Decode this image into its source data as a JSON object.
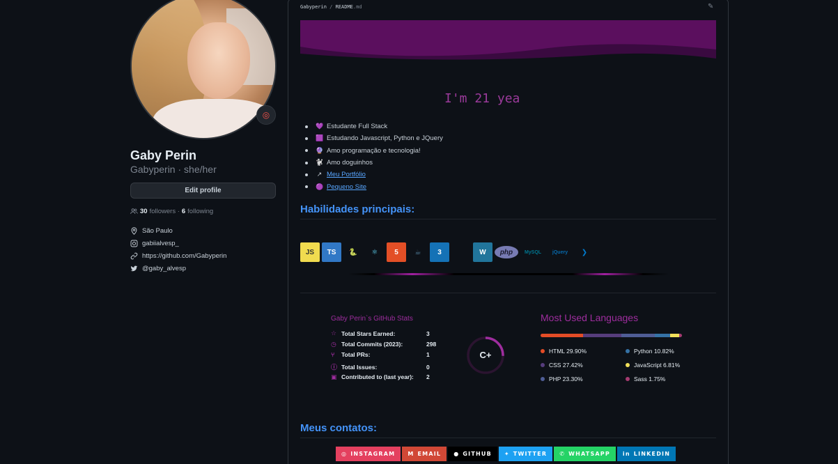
{
  "profile": {
    "name": "Gaby Perin",
    "username_pronouns": "Gabyperin · she/her",
    "edit_label": "Edit profile",
    "followers_count": "30",
    "followers_label": "followers ·",
    "following_count": "6",
    "following_label": "following",
    "location": "São Paulo",
    "instagram": "gabiialvesp_",
    "website": "https://github.com/Gabyperin",
    "twitter": "@gaby_alvesp"
  },
  "readme": {
    "path_user": "Gabyperin",
    "path_sep": "/",
    "path_file": "README",
    "path_ext": ".md",
    "typing_text": "I'm 21 yea",
    "bullets": [
      {
        "emoji": "💜",
        "text": "Estudante Full Stack"
      },
      {
        "emoji": "🟪",
        "text": "Estudando Javascript, Python e JQuery"
      },
      {
        "emoji": "🔮",
        "text": "Amo programação e tecnologia!"
      },
      {
        "emoji": "🐩",
        "text": "Amo doguinhos"
      },
      {
        "emoji": "↗",
        "text": "Meu Portfólio",
        "link": true
      },
      {
        "emoji": "🟣",
        "text": "Pequeno Site",
        "link": true
      }
    ],
    "skills_heading": "Habilidades principais:",
    "skills": [
      {
        "name": "JS",
        "bg": "#f0db4f",
        "fg": "#323330"
      },
      {
        "name": "TS",
        "bg": "#3178c6",
        "fg": "#ffffff"
      },
      {
        "name": "🐍",
        "bg": "transparent",
        "fg": "#3776ab"
      },
      {
        "name": "⚛",
        "bg": "transparent",
        "fg": "#61dafb"
      },
      {
        "name": "5",
        "bg": "#e34f26",
        "fg": "#ffffff"
      },
      {
        "name": "☕",
        "bg": "transparent",
        "fg": "#5382a1"
      },
      {
        "name": "3",
        "bg": "#1572b6",
        "fg": "#ffffff"
      },
      {
        "name": "",
        "bg": "transparent",
        "fg": "#0d1117"
      },
      {
        "name": "W",
        "bg": "#21759b",
        "fg": "#ffffff"
      },
      {
        "name": "php",
        "bg": "#777bb3",
        "fg": "#1b1b2f"
      },
      {
        "name": "MySQL",
        "bg": "transparent",
        "fg": "#00758f"
      },
      {
        "name": "jQuery",
        "bg": "transparent",
        "fg": "#0769ad"
      },
      {
        "name": "❯",
        "bg": "transparent",
        "fg": "#007acc"
      }
    ],
    "stats": {
      "title": "Gaby Perin`s GitHub Stats",
      "rows": [
        {
          "icon": "☆",
          "label": "Total Stars Earned:",
          "value": "3"
        },
        {
          "icon": "◷",
          "label": "Total Commits (2023):",
          "value": "298"
        },
        {
          "icon": "⑂",
          "label": "Total PRs:",
          "value": "1"
        },
        {
          "icon": "ⓘ",
          "label": "Total Issues:",
          "value": "0"
        },
        {
          "icon": "▣",
          "label": "Contributed to (last year):",
          "value": "2"
        }
      ],
      "rank": "C+"
    },
    "languages": {
      "title": "Most Used Languages",
      "items": [
        {
          "name": "HTML 29.90%",
          "color": "#e34c26",
          "pct": 29.9
        },
        {
          "name": "CSS 27.42%",
          "color": "#563d7c",
          "pct": 27.42
        },
        {
          "name": "PHP 23.30%",
          "color": "#4f5d95",
          "pct": 23.3
        },
        {
          "name": "Python 10.82%",
          "color": "#3572a5",
          "pct": 10.82
        },
        {
          "name": "JavaScript 6.81%",
          "color": "#f1e05a",
          "pct": 6.81
        },
        {
          "name": "Sass 1.75%",
          "color": "#a53b70",
          "pct": 1.75
        }
      ]
    },
    "contacts_heading": "Meus contatos:",
    "contacts": [
      {
        "label": "INSTAGRAM",
        "bg": "#e4405f",
        "icon": "◎"
      },
      {
        "label": "EMAIL",
        "bg": "#d14836",
        "icon": "M"
      },
      {
        "label": "GITHUB",
        "bg": "#000000",
        "icon": "●"
      },
      {
        "label": "TWITTER",
        "bg": "#1da1f2",
        "icon": "✦"
      },
      {
        "label": "WHATSAPP",
        "bg": "#25d366",
        "icon": "✆"
      },
      {
        "label": "LINKEDIN",
        "bg": "#0077b5",
        "icon": "in"
      }
    ]
  },
  "colors": {
    "accent_purple": "#9e2d9e",
    "link_blue": "#4493f8",
    "background": "#0d1117"
  }
}
